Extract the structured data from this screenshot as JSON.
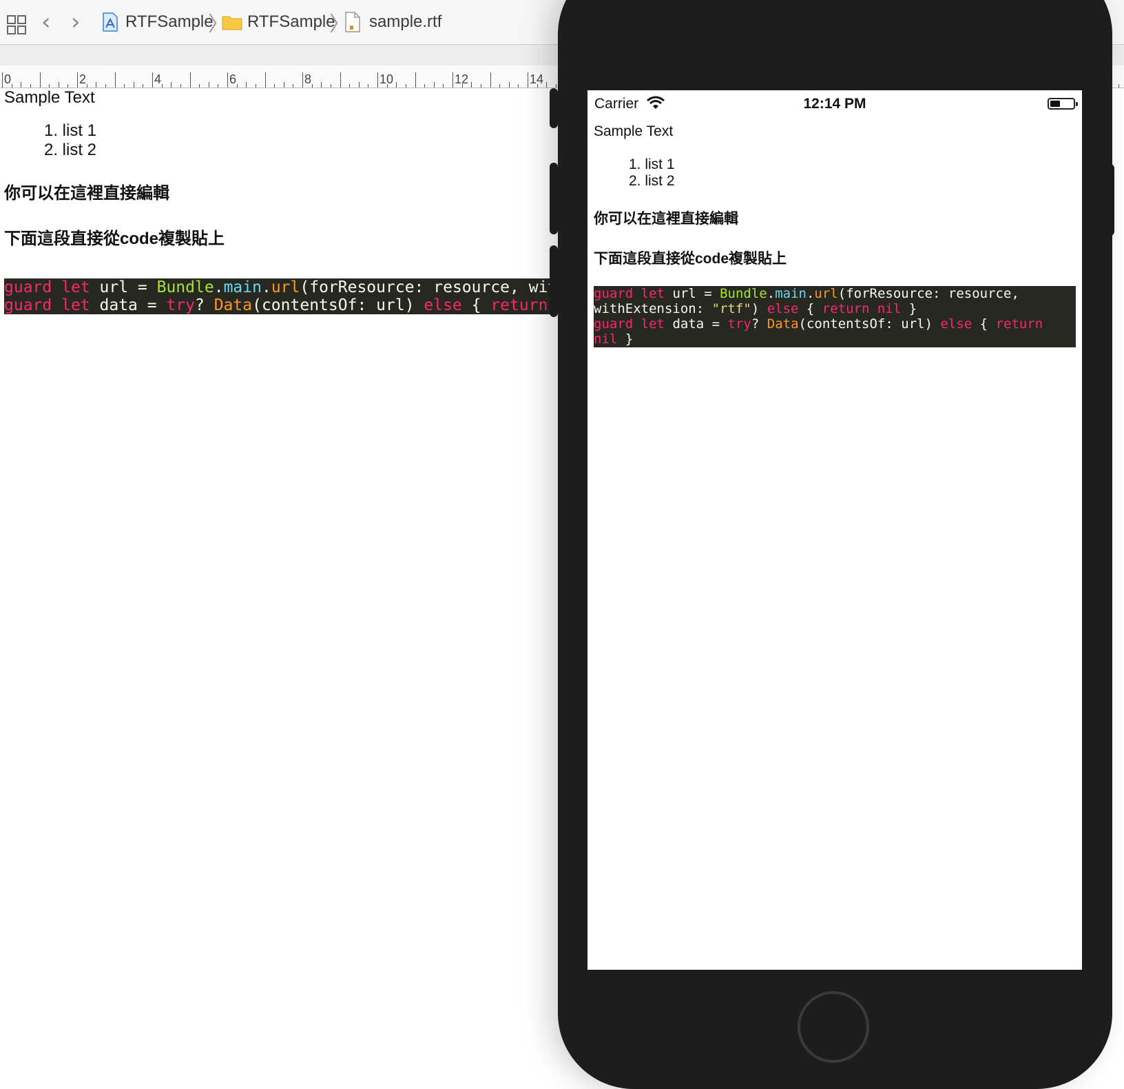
{
  "toolbar": {
    "breadcrumb": [
      {
        "label": "RTFSample",
        "icon": "xcode-project-icon"
      },
      {
        "label": "RTFSample",
        "icon": "folder-icon"
      },
      {
        "label": "sample.rtf",
        "icon": "rtf-file-icon"
      }
    ],
    "back_glyph": "‹",
    "forward_glyph": "›",
    "separator_glyph": "〉"
  },
  "ruler": {
    "labels": [
      "0",
      "2",
      "4",
      "6",
      "8",
      "10",
      "12",
      "14"
    ]
  },
  "editor": {
    "title": "Sample Text",
    "list": [
      "1. list 1",
      "2. list 2"
    ],
    "line_cjk_1": "你可以在這裡直接編輯",
    "line_cjk_2": "下面這段直接從code複製貼上",
    "code_line_1": "guard let url = Bundle.main.url(forResource: resource, withE",
    "code_line_2": "guard let data = try? Data(contentsOf: url) else { return ni"
  },
  "simulator": {
    "status": {
      "carrier": "Carrier",
      "time": "12:14 PM"
    },
    "title": "Sample Text",
    "list": [
      "1. list 1",
      "2. list 2"
    ],
    "line_cjk_1": "你可以在這裡直接編輯",
    "line_cjk_2": "下面這段直接從code複製貼上",
    "code_lines": [
      "guard let url = Bundle.main.url(forResource: resource,",
      "withExtension: \"rtf\") else { return nil }",
      "guard let data = try? Data(contentsOf: url) else { return",
      "nil }"
    ]
  },
  "colors": {
    "code_bg": "#272822",
    "keyword": "#f92672",
    "type": "#a6e22e",
    "member": "#66d9ef",
    "string": "#e6db74",
    "call": "#fd971f",
    "phone_body": "#1d1d1d"
  }
}
